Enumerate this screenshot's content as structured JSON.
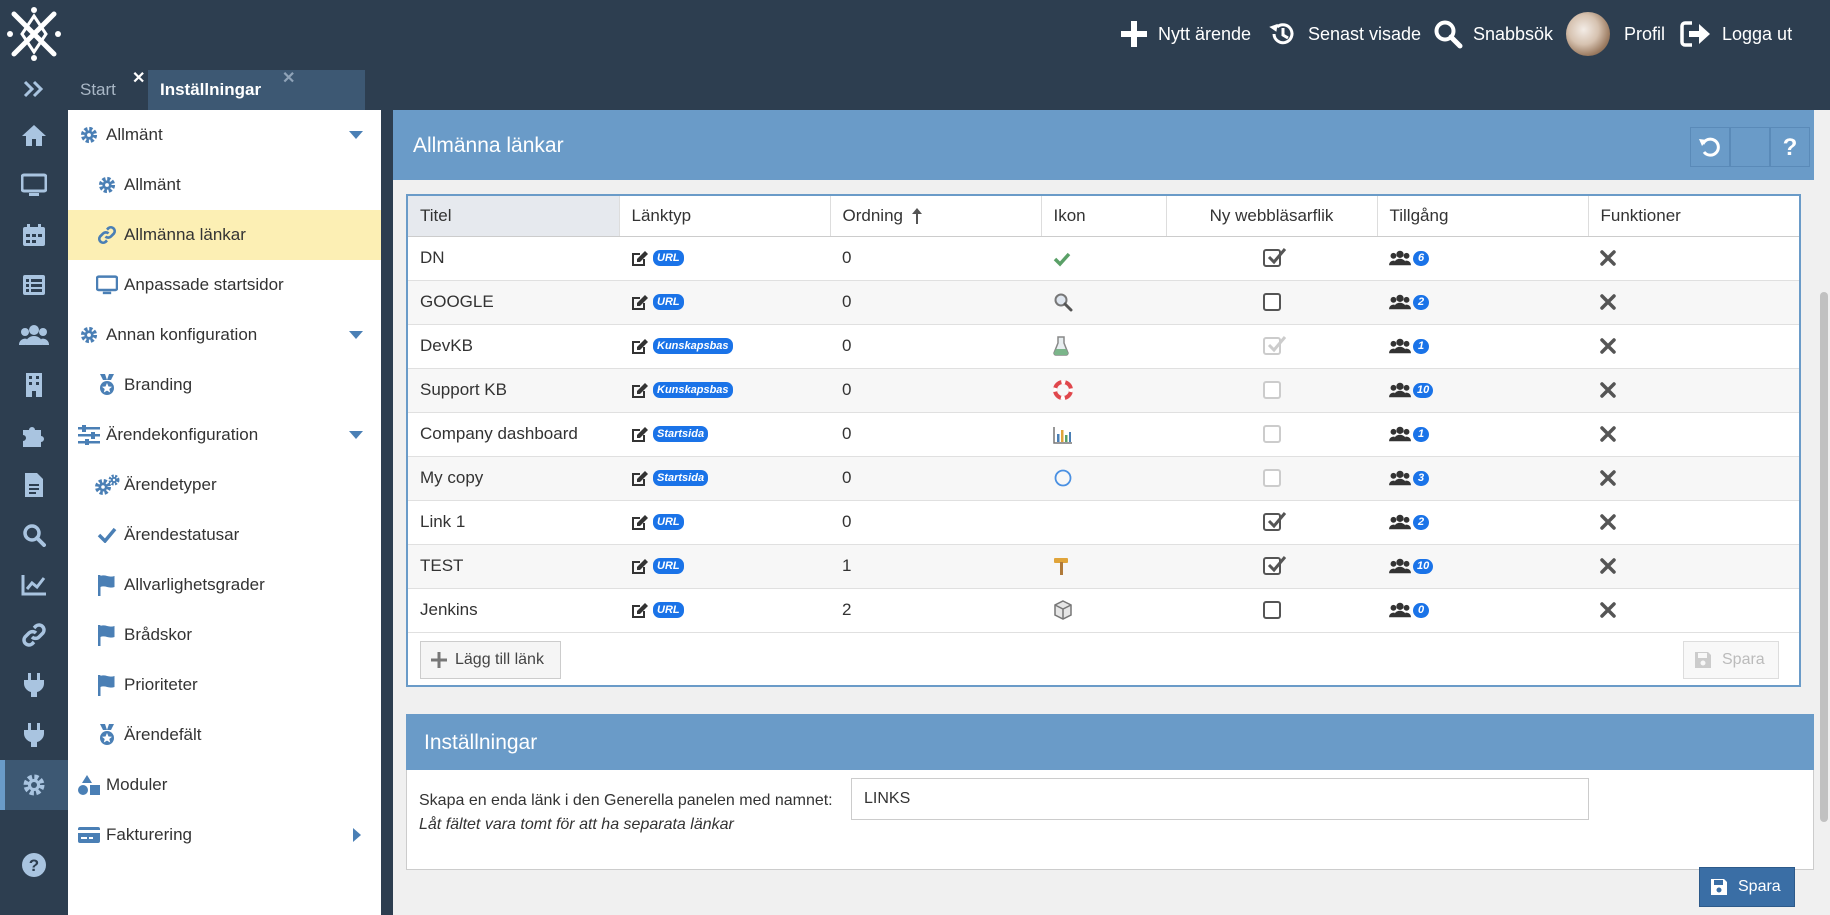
{
  "topbar": {
    "new_case": "Nytt ärende",
    "recent": "Senast visade",
    "quick_search": "Snabbsök",
    "profile": "Profil",
    "logout": "Logga ut"
  },
  "tabs": [
    {
      "label": "Start"
    },
    {
      "label": "Inställningar"
    }
  ],
  "sidebar": {
    "items": [
      {
        "label": "Allmänt"
      },
      {
        "label": "Allmänt"
      },
      {
        "label": "Allmänna länkar"
      },
      {
        "label": "Anpassade startsidor"
      },
      {
        "label": "Annan konfiguration"
      },
      {
        "label": "Branding"
      },
      {
        "label": "Ärendekonfiguration"
      },
      {
        "label": "Ärendetyper"
      },
      {
        "label": "Ärendestatusar"
      },
      {
        "label": "Allvarlighetsgrader"
      },
      {
        "label": "Brådskor"
      },
      {
        "label": "Prioriteter"
      },
      {
        "label": "Ärendefält"
      },
      {
        "label": "Moduler"
      },
      {
        "label": "Fakturering"
      }
    ]
  },
  "links_panel": {
    "title": "Allmänna länkar",
    "columns": [
      "Titel",
      "Länktyp",
      "Ordning",
      "Ikon",
      "Ny webbläsarflik",
      "Tillgång",
      "Funktioner"
    ],
    "rows": [
      {
        "title": "DN",
        "type": "URL",
        "order": "0",
        "icon": "checkmark-icon",
        "new_tab": true,
        "new_tab_disabled": false,
        "access": "6"
      },
      {
        "title": "GOOGLE",
        "type": "URL",
        "order": "0",
        "icon": "magnifier-icon",
        "new_tab": false,
        "new_tab_disabled": false,
        "access": "2"
      },
      {
        "title": "DevKB",
        "type": "Kunskapsbas",
        "order": "0",
        "icon": "flask-icon",
        "new_tab": true,
        "new_tab_disabled": true,
        "access": "1"
      },
      {
        "title": "Support KB",
        "type": "Kunskapsbas",
        "order": "0",
        "icon": "lifebuoy-icon",
        "new_tab": false,
        "new_tab_disabled": true,
        "access": "10"
      },
      {
        "title": "Company dashboard",
        "type": "Startsida",
        "order": "0",
        "icon": "bar-chart-icon",
        "new_tab": false,
        "new_tab_disabled": true,
        "access": "1"
      },
      {
        "title": "My copy",
        "type": "Startsida",
        "order": "0",
        "icon": "circle-icon",
        "new_tab": false,
        "new_tab_disabled": true,
        "access": "3"
      },
      {
        "title": "Link 1",
        "type": "URL",
        "order": "0",
        "icon": "",
        "new_tab": true,
        "new_tab_disabled": false,
        "access": "2"
      },
      {
        "title": "TEST",
        "type": "URL",
        "order": "1",
        "icon": "hammer-icon",
        "new_tab": true,
        "new_tab_disabled": false,
        "access": "10"
      },
      {
        "title": "Jenkins",
        "type": "URL",
        "order": "2",
        "icon": "cube-icon",
        "new_tab": false,
        "new_tab_disabled": false,
        "access": "0"
      }
    ],
    "add_button": "Lägg till länk",
    "save_button": "Spara"
  },
  "settings_panel": {
    "title": "Inställningar",
    "label": "Skapa en enda länk i den Generella panelen med namnet:",
    "hint": "Låt fältet vara tomt för att ha separata länkar",
    "value": "LINKS",
    "save_button": "Spara"
  },
  "colors": {
    "topbar": "#2d3e50",
    "panel_header": "#6a9bc8",
    "accent_blue": "#1a73e8",
    "selected_item": "#fcefb4",
    "icon_blue": "#4a7fb5"
  }
}
